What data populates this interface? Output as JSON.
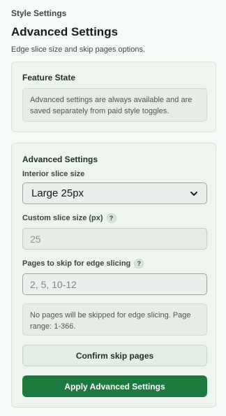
{
  "header": {
    "eyebrow": "Style Settings",
    "title": "Advanced Settings",
    "subtitle": "Edge slice size and skip pages options."
  },
  "feature_state": {
    "title": "Feature State",
    "note": "Advanced settings are always available and are saved separately from paid style toggles."
  },
  "advanced": {
    "title": "Advanced Settings",
    "interior_label": "Interior slice size",
    "interior_value": "Large 25px",
    "custom_label": "Custom slice size (px)",
    "custom_value": "25",
    "skip_label": "Pages to skip for edge slicing",
    "skip_placeholder": "2, 5, 10-12",
    "skip_note": "No pages will be skipped for edge slicing. Page range: 1-366.",
    "confirm_label": "Confirm skip pages",
    "apply_label": "Apply Advanced Settings",
    "help_glyph": "?"
  },
  "colors": {
    "accent": "#1d7a3e",
    "panel": "#eef5ef"
  }
}
